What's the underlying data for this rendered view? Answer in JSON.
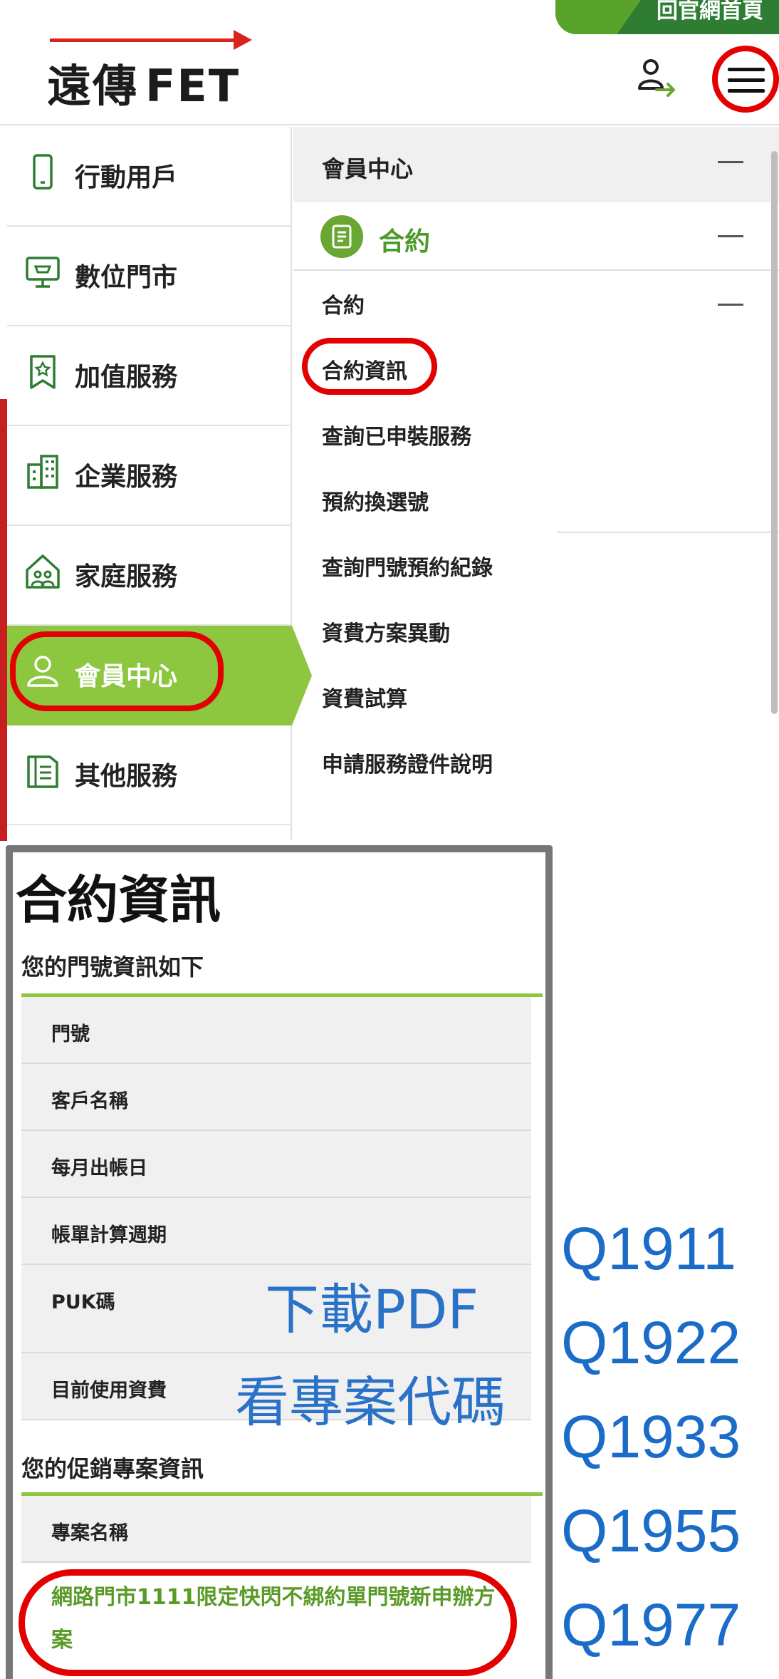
{
  "header": {
    "top_tab": "回官網首頁",
    "logo_text": "遠傳",
    "logo_brand": "FET",
    "icons": {
      "user": "user-login-icon",
      "menu": "hamburger-menu-icon"
    }
  },
  "leftnav": {
    "items": [
      {
        "label": "行動用戶",
        "icon": "mobile-phone-icon"
      },
      {
        "label": "數位門市",
        "icon": "digital-store-icon"
      },
      {
        "label": "加值服務",
        "icon": "bookmark-star-icon"
      },
      {
        "label": "企業服務",
        "icon": "buildings-icon"
      },
      {
        "label": "家庭服務",
        "icon": "home-family-icon"
      },
      {
        "label": "會員中心",
        "icon": "member-icon",
        "active": true
      },
      {
        "label": "其他服務",
        "icon": "book-icon"
      }
    ]
  },
  "rightpanel": {
    "header": "會員中心",
    "category": "合約",
    "subheader": "合約",
    "links": [
      "合約資訊",
      "查詢已申裝服務",
      "預約換選號",
      "查詢門號預約紀錄",
      "資費方案異動",
      "資費試算",
      "申請服務證件說明"
    ]
  },
  "contract": {
    "title": "合約資訊",
    "section1": "您的門號資訊如下",
    "rows": [
      "門號",
      "客戶名稱",
      "每月出帳日",
      "帳單計算週期",
      "PUK碼",
      "目前使用資費"
    ],
    "section2": "您的促銷專案資訊",
    "promo_header": "專案名稱",
    "promo_name": "網路門市1111限定快閃不綁約單門號新申辦方案"
  },
  "overlay": {
    "download": "下載PDF",
    "view_code": "看專案代碼",
    "codes": [
      "Q1911",
      "Q1922",
      "Q1933",
      "Q1955",
      "Q1977"
    ]
  },
  "colors": {
    "accent_green": "#8dc63f",
    "dark_green": "#2e7d32",
    "fet_red": "#d9231b",
    "highlight_red": "#e30000",
    "overlay_blue": "#1a6cc8"
  }
}
